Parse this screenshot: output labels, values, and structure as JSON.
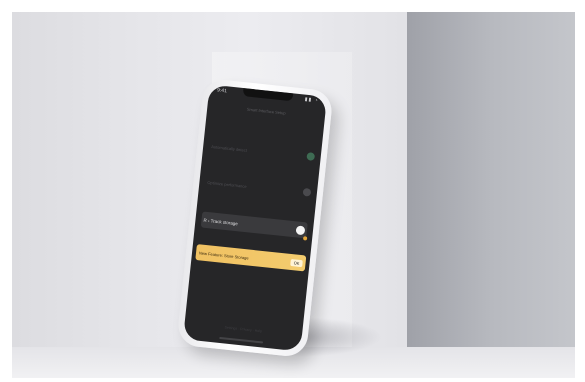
{
  "status_bar": {
    "time": "9:41",
    "icons": "▮▮ ◔"
  },
  "screen_title": "Smart Interface Setup",
  "settings": [
    {
      "label": "Automatically detect",
      "accent": "#3e6b53"
    },
    {
      "label": "Optimize performance",
      "accent": "#4a4a4e"
    },
    {
      "label": "Track storage",
      "prefix": "R ›",
      "accent": "#f5f5f5"
    }
  ],
  "banner": {
    "text": "New Feature: Store Storage",
    "button": "OK"
  },
  "footer": "Settings · Privacy · Help",
  "colors": {
    "screen_bg": "#262628",
    "banner": "#f0c162",
    "wall_dark": "#9fa1a8"
  }
}
